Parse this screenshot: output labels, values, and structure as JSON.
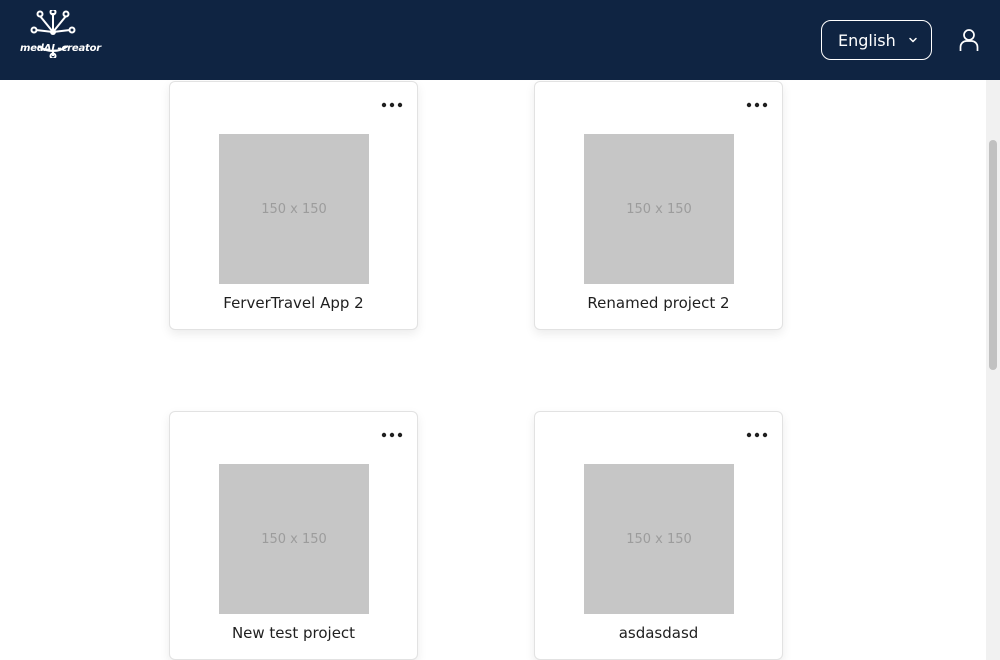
{
  "header": {
    "logo_text": "medAL-creator",
    "brand_color": "#0f2442",
    "language": {
      "selected": "English",
      "icon": "chevron-down-icon"
    },
    "user_icon": "user-icon"
  },
  "projects": [
    {
      "name": "FerverTravel App 2",
      "thumbnail_label": "150 x 150",
      "menu_icon": "more-horizontal-icon"
    },
    {
      "name": "Renamed project 2",
      "thumbnail_label": "150 x 150",
      "menu_icon": "more-horizontal-icon"
    },
    {
      "name": "New test project",
      "thumbnail_label": "150 x 150",
      "menu_icon": "more-horizontal-icon"
    },
    {
      "name": "asdasdasd",
      "thumbnail_label": "150 x 150",
      "menu_icon": "more-horizontal-icon"
    }
  ]
}
